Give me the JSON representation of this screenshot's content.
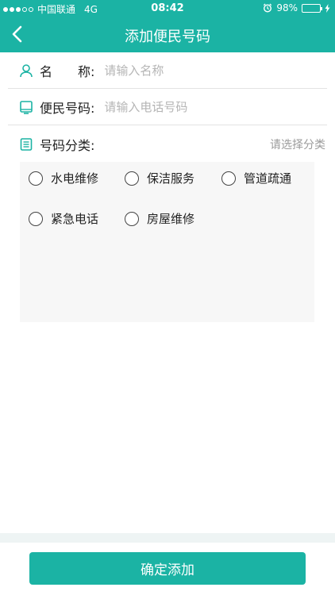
{
  "status_bar": {
    "carrier": "中国联通",
    "network": "4G",
    "time": "08:42",
    "battery": "98%",
    "battery_level": 0.98
  },
  "nav": {
    "title": "添加便民号码",
    "back_icon": "chevron-left-icon"
  },
  "form": {
    "name": {
      "label": "名　　称:",
      "placeholder": "请输入名称",
      "icon": "user-icon"
    },
    "phone": {
      "label": "便民号码:",
      "placeholder": "请输入电话号码",
      "icon": "tablet-icon"
    },
    "category": {
      "label": "号码分类:",
      "hint": "请选择分类",
      "icon": "list-icon",
      "options": [
        "水电维修",
        "保洁服务",
        "管道疏通",
        "紧急电话",
        "房屋维修"
      ]
    }
  },
  "submit_label": "确定添加",
  "colors": {
    "primary": "#1bb3a4",
    "placeholder": "#b5b5b5",
    "options_bg": "#f7f7f7"
  }
}
